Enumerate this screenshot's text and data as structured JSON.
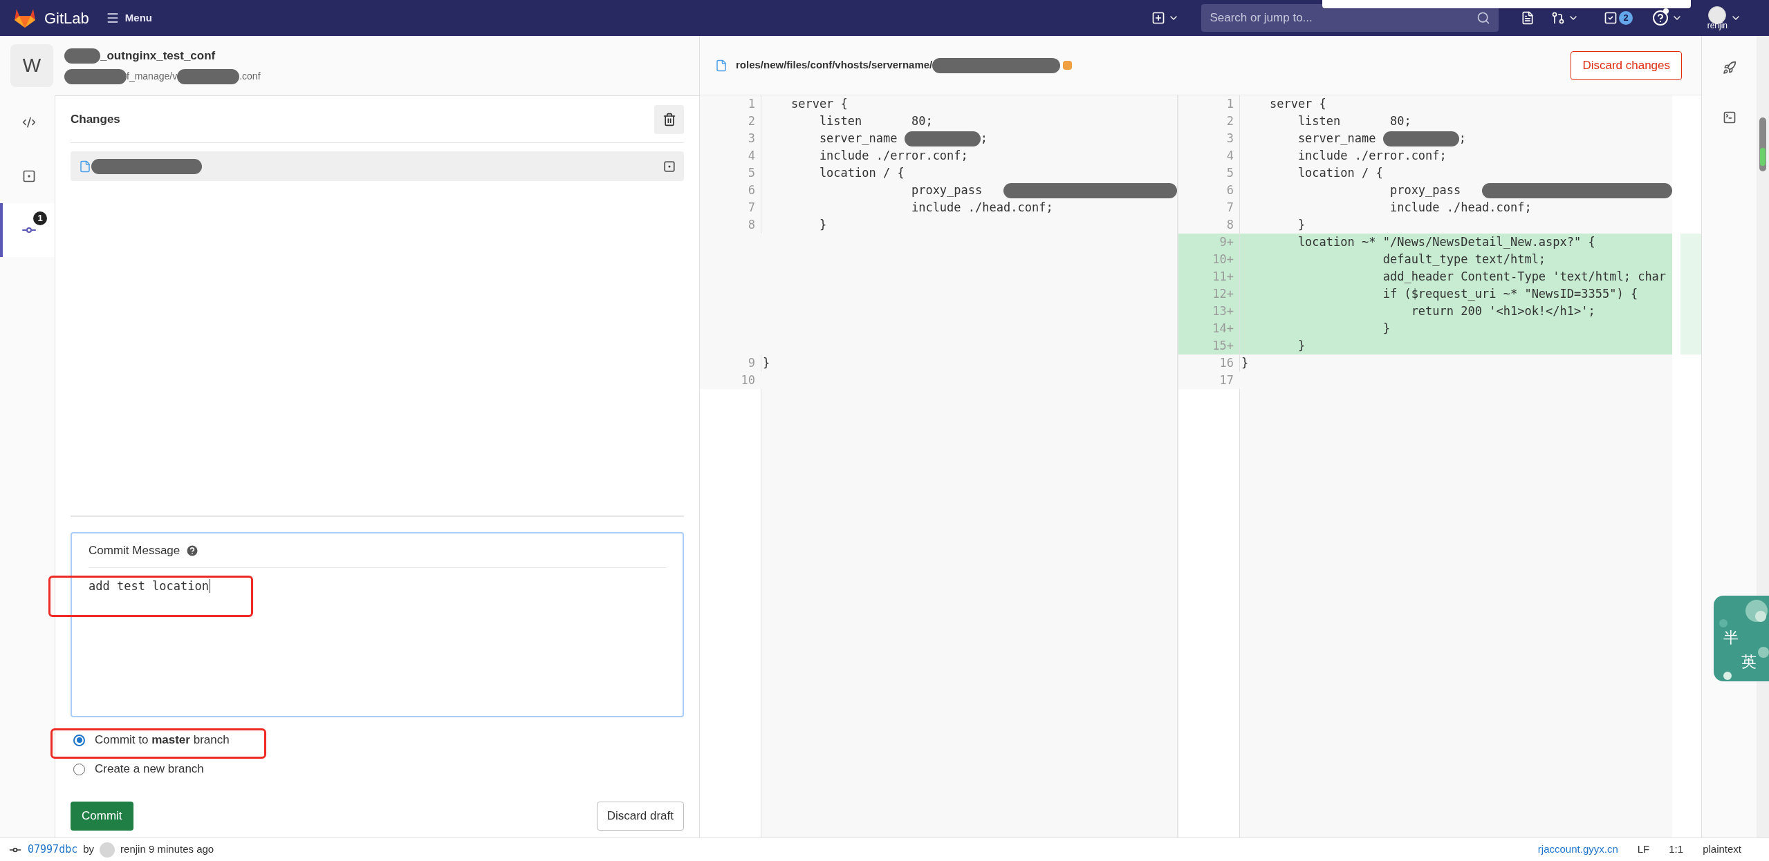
{
  "top_bar": {
    "logo_text": "GitLab",
    "menu_label": "Menu",
    "search": {
      "placeholder": "Search or jump to..."
    },
    "todo_count": "2",
    "user": "renjin"
  },
  "project": {
    "avatar_letter": "W",
    "name": [
      {
        "kind": "redaction"
      },
      {
        "kind": "text",
        "text": "_outnginx_test_conf"
      }
    ],
    "path": [
      {
        "kind": "redaction"
      },
      {
        "kind": "text",
        "text": "f_manage/v"
      },
      {
        "kind": "redaction"
      },
      {
        "kind": "text",
        "text": ".conf"
      }
    ]
  },
  "rail": [
    {
      "kind": "code",
      "selected": false
    },
    {
      "kind": "review",
      "selected": false
    },
    {
      "kind": "commit",
      "selected": true,
      "badge": "1"
    }
  ],
  "changes": {
    "title": "Changes",
    "files": [
      {
        "name": [
          {
            "kind": "redaction"
          }
        ]
      }
    ]
  },
  "commit_form": {
    "label": "Commit Message",
    "value": "add test location",
    "options": [
      {
        "label": "Commit to **master** branch",
        "selected": true
      },
      {
        "label": "Create a new branch",
        "selected": false
      }
    ],
    "commit_button": "Commit",
    "discard_button": "Discard draft"
  },
  "editor": {
    "file_path": [
      {
        "kind": "text",
        "text": "roles/new/files/conf/vhosts/servername/"
      },
      {
        "kind": "redaction"
      }
    ],
    "discard_button": "Discard changes",
    "original": [
      {
        "number": "1",
        "parts": [
          {
            "kind": "text",
            "text": "    server {"
          }
        ]
      },
      {
        "number": "2",
        "parts": [
          {
            "kind": "text",
            "text": "        listen       80;"
          }
        ]
      },
      {
        "number": "3",
        "parts": [
          {
            "kind": "text",
            "text": "        server_name "
          },
          {
            "kind": "redaction"
          },
          {
            "kind": "text",
            "text": ";"
          }
        ]
      },
      {
        "number": "4",
        "parts": [
          {
            "kind": "text",
            "text": "        include ./error.conf;"
          }
        ]
      },
      {
        "number": "5",
        "parts": [
          {
            "kind": "text",
            "text": "        location / {"
          }
        ]
      },
      {
        "number": "6",
        "parts": [
          {
            "kind": "text",
            "text": "                     proxy_pass   "
          },
          {
            "kind": "redaction"
          }
        ]
      },
      {
        "number": "7",
        "parts": [
          {
            "kind": "text",
            "text": "                     include ./head.conf;"
          }
        ]
      },
      {
        "number": "8",
        "parts": [
          {
            "kind": "text",
            "text": "        }"
          }
        ]
      },
      {
        "number": "9",
        "parts": [
          {
            "kind": "text",
            "text": "}"
          }
        ]
      },
      {
        "number": "10"
      }
    ],
    "modified": [
      {
        "number": "1",
        "added": false,
        "parts": [
          {
            "kind": "text",
            "text": "    server {"
          }
        ]
      },
      {
        "number": "2",
        "added": false,
        "parts": [
          {
            "kind": "text",
            "text": "        listen       80;"
          }
        ]
      },
      {
        "number": "3",
        "added": false,
        "parts": [
          {
            "kind": "text",
            "text": "        server_name "
          },
          {
            "kind": "redaction"
          },
          {
            "kind": "text",
            "text": ";"
          }
        ]
      },
      {
        "number": "4",
        "added": false,
        "parts": [
          {
            "kind": "text",
            "text": "        include ./error.conf;"
          }
        ]
      },
      {
        "number": "5",
        "added": false,
        "parts": [
          {
            "kind": "text",
            "text": "        location / {"
          }
        ]
      },
      {
        "number": "6",
        "added": false,
        "parts": [
          {
            "kind": "text",
            "text": "                     proxy_pass   "
          },
          {
            "kind": "redaction"
          }
        ]
      },
      {
        "number": "7",
        "added": false,
        "parts": [
          {
            "kind": "text",
            "text": "                     include ./head.conf;"
          }
        ]
      },
      {
        "number": "8",
        "added": false,
        "parts": [
          {
            "kind": "text",
            "text": "        }"
          }
        ]
      },
      {
        "number": "9+",
        "added": true,
        "parts": [
          {
            "kind": "text",
            "text": "        location ~* \"/News/NewsDetail_New.aspx?\" {"
          }
        ]
      },
      {
        "number": "10+",
        "added": true,
        "parts": [
          {
            "kind": "text",
            "text": "                    default_type text/html;"
          }
        ]
      },
      {
        "number": "11+",
        "added": true,
        "parts": [
          {
            "kind": "text",
            "text": "                    add_header Content-Type 'text/html; char"
          }
        ]
      },
      {
        "number": "12+",
        "added": true,
        "parts": [
          {
            "kind": "text",
            "text": "                    if ($request_uri ~* \"NewsID=3355\") {"
          }
        ]
      },
      {
        "number": "13+",
        "added": true,
        "parts": [
          {
            "kind": "text",
            "text": "                        return 200 '<h1>ok!</h1>';"
          }
        ]
      },
      {
        "number": "14+",
        "added": true,
        "parts": [
          {
            "kind": "text",
            "text": "                    }"
          }
        ]
      },
      {
        "number": "15+",
        "added": true,
        "parts": [
          {
            "kind": "text",
            "text": "        }"
          }
        ]
      },
      {
        "number": "16",
        "added": false,
        "parts": [
          {
            "kind": "text",
            "text": "}"
          }
        ]
      },
      {
        "number": "17",
        "added": false
      }
    ]
  },
  "status_bar": {
    "commit_sha": "07997dbc",
    "by": "by",
    "author_time": "renjin 9 minutes ago",
    "host": "rjaccount.gyyx.cn",
    "eol": "LF",
    "position": "1:1",
    "language": "plaintext"
  },
  "ime_widget": {
    "chars": [
      "半",
      "英"
    ]
  }
}
